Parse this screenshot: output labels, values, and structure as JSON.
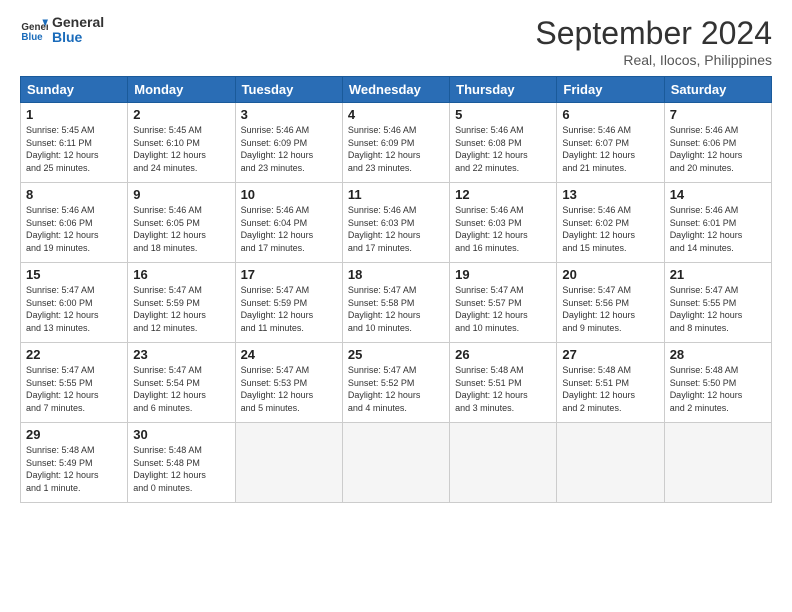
{
  "header": {
    "logo_text_general": "General",
    "logo_text_blue": "Blue",
    "month_title": "September 2024",
    "subtitle": "Real, Ilocos, Philippines"
  },
  "weekdays": [
    "Sunday",
    "Monday",
    "Tuesday",
    "Wednesday",
    "Thursday",
    "Friday",
    "Saturday"
  ],
  "days": [
    {
      "num": "",
      "info": ""
    },
    {
      "num": "",
      "info": ""
    },
    {
      "num": "",
      "info": ""
    },
    {
      "num": "",
      "info": ""
    },
    {
      "num": "",
      "info": ""
    },
    {
      "num": "",
      "info": ""
    },
    {
      "num": "",
      "info": ""
    },
    {
      "num": "1",
      "info": "Sunrise: 5:45 AM\nSunset: 6:11 PM\nDaylight: 12 hours\nand 25 minutes."
    },
    {
      "num": "2",
      "info": "Sunrise: 5:45 AM\nSunset: 6:10 PM\nDaylight: 12 hours\nand 24 minutes."
    },
    {
      "num": "3",
      "info": "Sunrise: 5:46 AM\nSunset: 6:09 PM\nDaylight: 12 hours\nand 23 minutes."
    },
    {
      "num": "4",
      "info": "Sunrise: 5:46 AM\nSunset: 6:09 PM\nDaylight: 12 hours\nand 23 minutes."
    },
    {
      "num": "5",
      "info": "Sunrise: 5:46 AM\nSunset: 6:08 PM\nDaylight: 12 hours\nand 22 minutes."
    },
    {
      "num": "6",
      "info": "Sunrise: 5:46 AM\nSunset: 6:07 PM\nDaylight: 12 hours\nand 21 minutes."
    },
    {
      "num": "7",
      "info": "Sunrise: 5:46 AM\nSunset: 6:06 PM\nDaylight: 12 hours\nand 20 minutes."
    },
    {
      "num": "8",
      "info": "Sunrise: 5:46 AM\nSunset: 6:06 PM\nDaylight: 12 hours\nand 19 minutes."
    },
    {
      "num": "9",
      "info": "Sunrise: 5:46 AM\nSunset: 6:05 PM\nDaylight: 12 hours\nand 18 minutes."
    },
    {
      "num": "10",
      "info": "Sunrise: 5:46 AM\nSunset: 6:04 PM\nDaylight: 12 hours\nand 17 minutes."
    },
    {
      "num": "11",
      "info": "Sunrise: 5:46 AM\nSunset: 6:03 PM\nDaylight: 12 hours\nand 17 minutes."
    },
    {
      "num": "12",
      "info": "Sunrise: 5:46 AM\nSunset: 6:03 PM\nDaylight: 12 hours\nand 16 minutes."
    },
    {
      "num": "13",
      "info": "Sunrise: 5:46 AM\nSunset: 6:02 PM\nDaylight: 12 hours\nand 15 minutes."
    },
    {
      "num": "14",
      "info": "Sunrise: 5:46 AM\nSunset: 6:01 PM\nDaylight: 12 hours\nand 14 minutes."
    },
    {
      "num": "15",
      "info": "Sunrise: 5:47 AM\nSunset: 6:00 PM\nDaylight: 12 hours\nand 13 minutes."
    },
    {
      "num": "16",
      "info": "Sunrise: 5:47 AM\nSunset: 5:59 PM\nDaylight: 12 hours\nand 12 minutes."
    },
    {
      "num": "17",
      "info": "Sunrise: 5:47 AM\nSunset: 5:59 PM\nDaylight: 12 hours\nand 11 minutes."
    },
    {
      "num": "18",
      "info": "Sunrise: 5:47 AM\nSunset: 5:58 PM\nDaylight: 12 hours\nand 10 minutes."
    },
    {
      "num": "19",
      "info": "Sunrise: 5:47 AM\nSunset: 5:57 PM\nDaylight: 12 hours\nand 10 minutes."
    },
    {
      "num": "20",
      "info": "Sunrise: 5:47 AM\nSunset: 5:56 PM\nDaylight: 12 hours\nand 9 minutes."
    },
    {
      "num": "21",
      "info": "Sunrise: 5:47 AM\nSunset: 5:55 PM\nDaylight: 12 hours\nand 8 minutes."
    },
    {
      "num": "22",
      "info": "Sunrise: 5:47 AM\nSunset: 5:55 PM\nDaylight: 12 hours\nand 7 minutes."
    },
    {
      "num": "23",
      "info": "Sunrise: 5:47 AM\nSunset: 5:54 PM\nDaylight: 12 hours\nand 6 minutes."
    },
    {
      "num": "24",
      "info": "Sunrise: 5:47 AM\nSunset: 5:53 PM\nDaylight: 12 hours\nand 5 minutes."
    },
    {
      "num": "25",
      "info": "Sunrise: 5:47 AM\nSunset: 5:52 PM\nDaylight: 12 hours\nand 4 minutes."
    },
    {
      "num": "26",
      "info": "Sunrise: 5:48 AM\nSunset: 5:51 PM\nDaylight: 12 hours\nand 3 minutes."
    },
    {
      "num": "27",
      "info": "Sunrise: 5:48 AM\nSunset: 5:51 PM\nDaylight: 12 hours\nand 2 minutes."
    },
    {
      "num": "28",
      "info": "Sunrise: 5:48 AM\nSunset: 5:50 PM\nDaylight: 12 hours\nand 2 minutes."
    },
    {
      "num": "29",
      "info": "Sunrise: 5:48 AM\nSunset: 5:49 PM\nDaylight: 12 hours\nand 1 minute."
    },
    {
      "num": "30",
      "info": "Sunrise: 5:48 AM\nSunset: 5:48 PM\nDaylight: 12 hours\nand 0 minutes."
    },
    {
      "num": "",
      "info": ""
    },
    {
      "num": "",
      "info": ""
    },
    {
      "num": "",
      "info": ""
    },
    {
      "num": "",
      "info": ""
    },
    {
      "num": "",
      "info": ""
    }
  ]
}
